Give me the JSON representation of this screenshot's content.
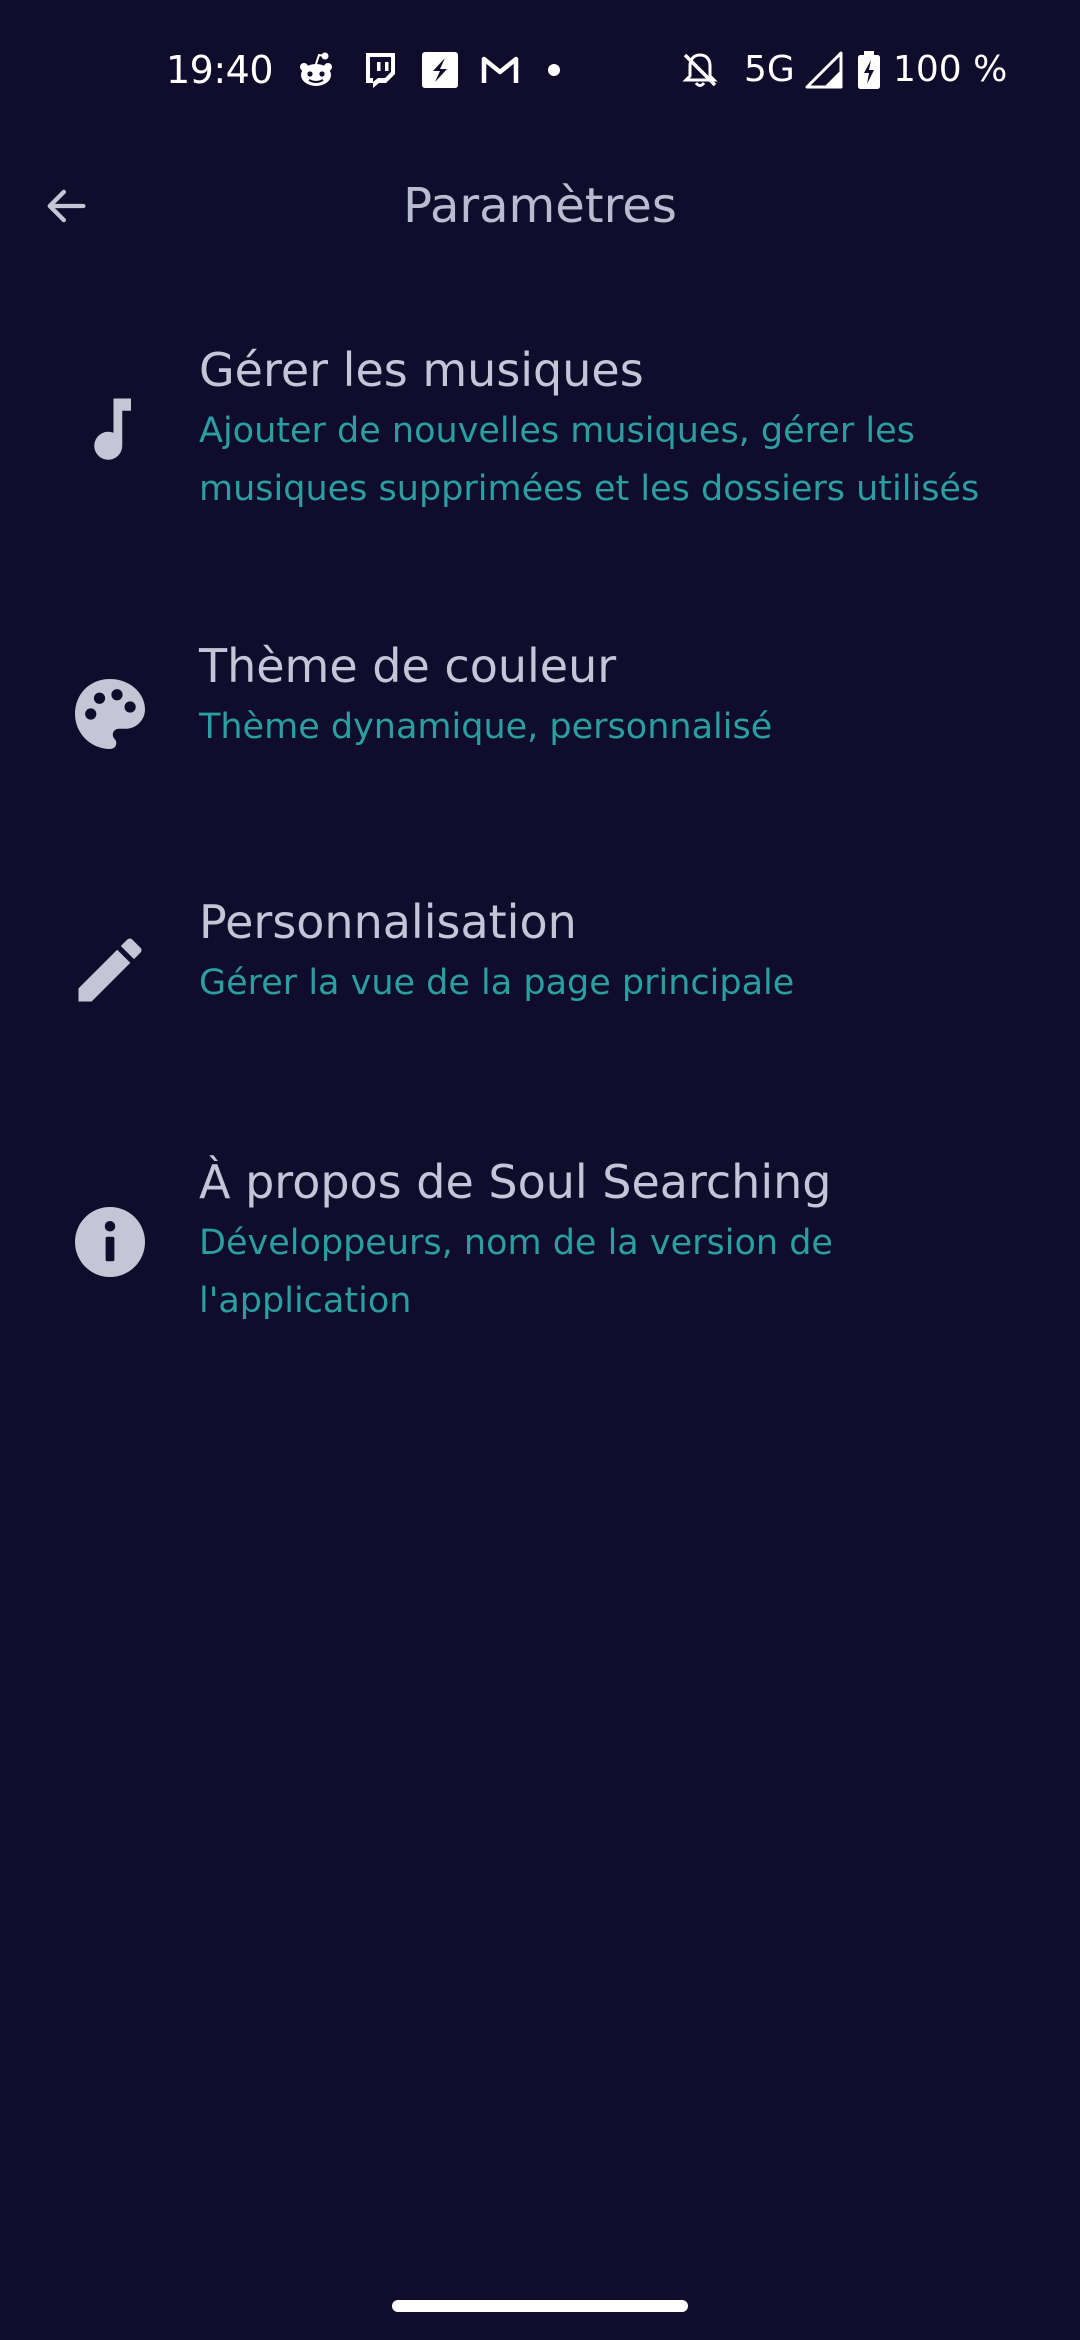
{
  "status_bar": {
    "time": "19:40",
    "network": "5G",
    "battery": "100 %",
    "notification_icons": [
      "reddit-icon",
      "twitch-icon",
      "s-app-icon",
      "gmail-icon",
      "more-dot-icon"
    ],
    "system_icons": [
      "notifications-off-icon",
      "signal-icon",
      "battery-charging-icon"
    ]
  },
  "app_bar": {
    "back_icon": "arrow-back-icon",
    "title": "Paramètres"
  },
  "settings": [
    {
      "icon": "music-note-icon",
      "title": "Gérer les musiques",
      "subtitle": "Ajouter de nouvelles musiques, gérer les musiques supprimées et les dossiers utilisés"
    },
    {
      "icon": "palette-icon",
      "title": "Thème de couleur",
      "subtitle": "Thème dynamique, personnalisé"
    },
    {
      "icon": "pencil-icon",
      "title": "Personnalisation",
      "subtitle": "Gérer la vue de la page principale"
    },
    {
      "icon": "info-icon",
      "title": "À propos de Soul Searching",
      "subtitle": "Développeurs, nom de la version de l'application"
    }
  ],
  "colors": {
    "background": "#0f0d2b",
    "title_text": "#c4c6d8",
    "subtitle_text": "#2a9ea0",
    "icon": "#c4c6d6"
  }
}
